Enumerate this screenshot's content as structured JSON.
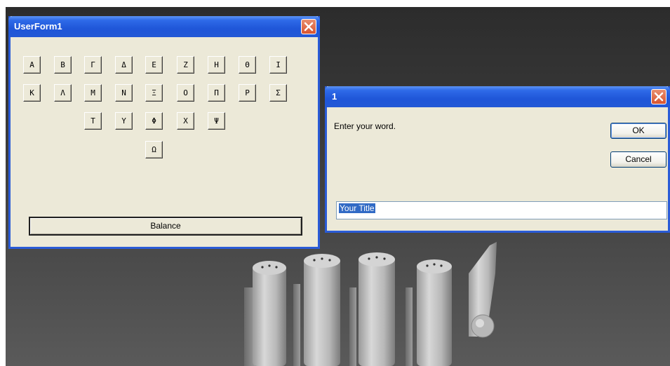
{
  "userform": {
    "title": "UserForm1",
    "greek_rows": [
      [
        "Α",
        "Β",
        "Γ",
        "Δ",
        "Ε",
        "Ζ",
        "Η",
        "Θ",
        "Ι"
      ],
      [
        "Κ",
        "Λ",
        "Μ",
        "Ν",
        "Ξ",
        "Ο",
        "Π",
        "Ρ",
        "Σ"
      ],
      [
        "Τ",
        "Υ",
        "Φ",
        "Χ",
        "Ψ"
      ],
      [
        "Ω"
      ]
    ],
    "balance_label": "Balance"
  },
  "inputbox": {
    "title": "1",
    "prompt": "Enter your word.",
    "ok_label": "OK",
    "cancel_label": "Cancel",
    "value": "Your Title"
  },
  "colors": {
    "titlebar_blue": "#2358d6",
    "close_red": "#d9532f",
    "dialog_face": "#ece9d8",
    "selection_blue": "#316ac5"
  }
}
